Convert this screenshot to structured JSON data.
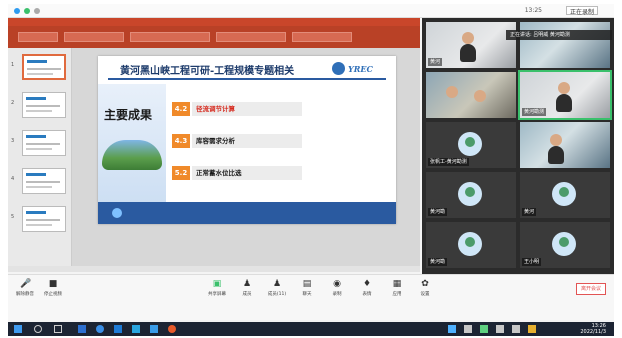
{
  "topbar": {
    "time": "13:25",
    "status_label": "正在录制"
  },
  "presentation": {
    "slide_title": "黄河黑山峡工程可研-工程规模专题相关",
    "logo_text": "YREC",
    "main_heading": "主要成果",
    "items": [
      {
        "num": "4.2",
        "label": "径流调节计算",
        "num_color": "#f08a2a",
        "label_color": "#d62b1f"
      },
      {
        "num": "4.3",
        "label": "库容需求分析",
        "num_color": "#f08a2a",
        "label_color": "#1a1a1a"
      },
      {
        "num": "5.2",
        "label": "正常蓄水位比选",
        "num_color": "#f08a2a",
        "label_color": "#1a1a1a"
      }
    ],
    "thumb_numbers": [
      "1",
      "2",
      "3",
      "4",
      "5"
    ]
  },
  "notice": "正在讲话: 吕明威 黄河勘测",
  "participants": [
    {
      "name": "黄河"
    },
    {
      "name": ""
    },
    {
      "name": ""
    },
    {
      "name": "黄河勘测"
    },
    {
      "name": "张帆工-黄河勘测"
    },
    {
      "name": "黄河勘"
    },
    {
      "name": "黄河"
    },
    {
      "name": "黄河勘"
    },
    {
      "name": "黄河"
    },
    {
      "name": "王小明"
    }
  ],
  "toolbar": {
    "left": [
      {
        "label": "解除静音",
        "icon": "mic-icon"
      },
      {
        "label": "停止视频",
        "icon": "camera-icon"
      }
    ],
    "center": [
      {
        "label": "共享屏幕",
        "icon": "share-screen-icon"
      },
      {
        "label": "成员",
        "icon": "members-icon"
      },
      {
        "label": "成员(11)",
        "icon": "members-count-icon"
      },
      {
        "label": "聊天",
        "icon": "chat-icon"
      },
      {
        "label": "录制",
        "icon": "record-icon"
      },
      {
        "label": "表情",
        "icon": "reaction-icon"
      },
      {
        "label": "应用",
        "icon": "apps-icon"
      },
      {
        "label": "设置",
        "icon": "settings-icon"
      }
    ],
    "end_label": "离开会议"
  },
  "taskbar": {
    "clock_time": "13:26",
    "clock_date": "2022/11/3"
  },
  "colors": {
    "accent_blue": "#2a5aa0",
    "ppt_red": "#c9462a",
    "end_red": "#e25454"
  }
}
